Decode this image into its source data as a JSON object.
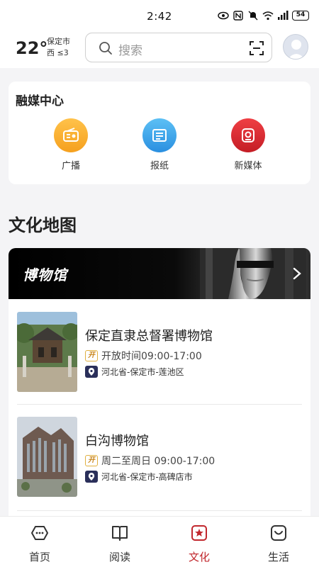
{
  "status_bar": {
    "time": "2:42",
    "battery": "54",
    "network": "4G"
  },
  "header": {
    "temperature": "22°",
    "city": "保定市",
    "wind": "西 ≤3",
    "search_placeholder": "搜索",
    "icons": [
      "search-icon",
      "scan-icon",
      "avatar"
    ]
  },
  "media_center": {
    "title": "融媒中心",
    "items": [
      {
        "label": "广播",
        "icon": "radio-icon",
        "color": "#f5a623"
      },
      {
        "label": "报纸",
        "icon": "newspaper-icon",
        "color": "#3aa3e8"
      },
      {
        "label": "新媒体",
        "icon": "new-media-icon",
        "color": "#d9282f"
      }
    ]
  },
  "culture_map": {
    "title": "文化地图",
    "banner_title": "博物馆",
    "museums": [
      {
        "name": "保定直隶总督署博物馆",
        "open_badge": "开",
        "hours": "开放时间09:00-17:00",
        "address": "河北省-保定市-莲池区"
      },
      {
        "name": "白沟博物馆",
        "open_badge": "开",
        "hours": "周二至周日 09:00-17:00",
        "address": "河北省-保定市-高碑店市"
      }
    ]
  },
  "bottom_nav": {
    "items": [
      {
        "label": "首页",
        "icon": "home-icon"
      },
      {
        "label": "阅读",
        "icon": "book-icon"
      },
      {
        "label": "文化",
        "icon": "culture-icon",
        "active": true
      },
      {
        "label": "生活",
        "icon": "life-icon"
      }
    ],
    "active_color": "#c1272d"
  }
}
